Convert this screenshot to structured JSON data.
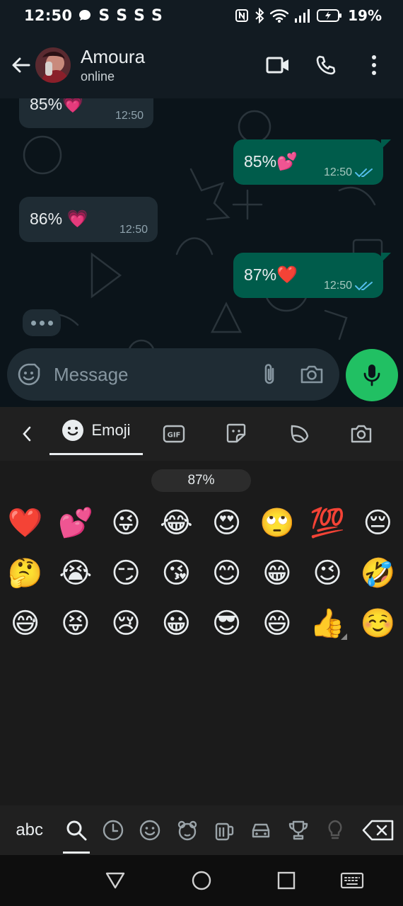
{
  "status_bar": {
    "time": "12:50",
    "s_icons": [
      "S",
      "S",
      "S",
      "S"
    ],
    "battery": "19%"
  },
  "header": {
    "contact_name": "Amoura",
    "contact_status": "online"
  },
  "messages": [
    {
      "direction": "in",
      "text": "85%",
      "emoji": "💗",
      "time": "12:50"
    },
    {
      "direction": "out",
      "text": "85%",
      "emoji": "💕",
      "time": "12:50",
      "ticks": "read"
    },
    {
      "direction": "in",
      "text": "86%",
      "emoji": "💗",
      "time": "12:50"
    },
    {
      "direction": "out",
      "text": "87%",
      "emoji": "❤️",
      "time": "12:50",
      "ticks": "read"
    }
  ],
  "composer": {
    "placeholder": "Message"
  },
  "keyboard": {
    "tab_label": "Emoji",
    "search_value": "87%",
    "emojis": [
      "❤️",
      "💕",
      "😜",
      "😂",
      "😍",
      "🙄",
      "💯",
      "😔",
      "🤔",
      "😭",
      "😏",
      "😘",
      "😊",
      "😁",
      "😉",
      "🤣",
      "😅",
      "😝",
      "😢",
      "😀",
      "😎",
      "😄",
      "👍",
      "☺️"
    ],
    "abc_label": "abc"
  },
  "colors": {
    "incoming": "#1f2c34",
    "outgoing": "#005c4b",
    "accent": "#21c063",
    "tick": "#53bdeb"
  }
}
